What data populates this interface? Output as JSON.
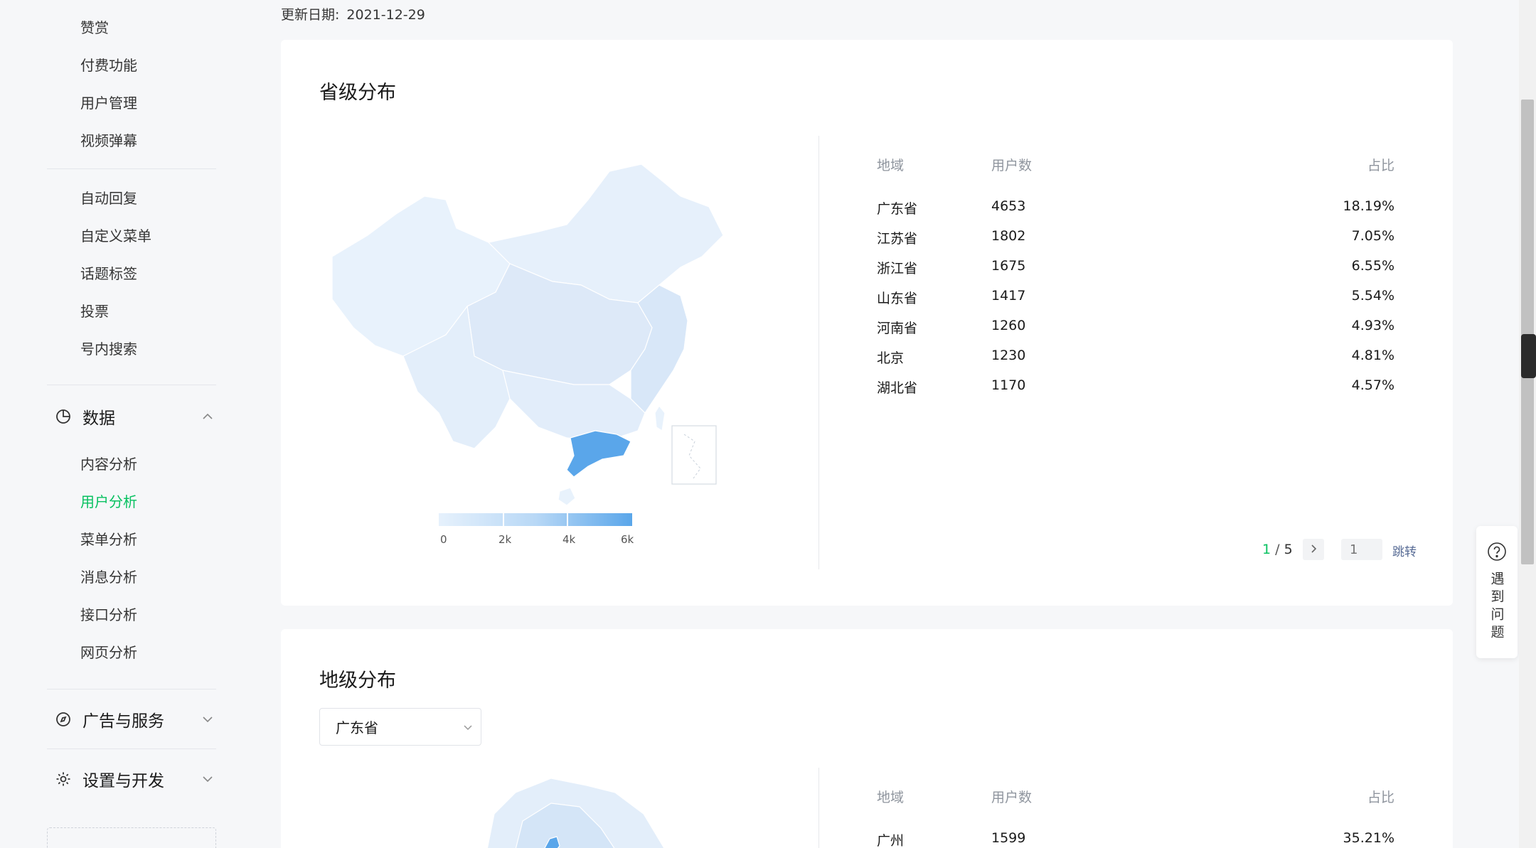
{
  "sidebar": {
    "top_items": [
      {
        "label": "赞赏"
      },
      {
        "label": "付费功能"
      },
      {
        "label": "用户管理"
      },
      {
        "label": "视频弹幕"
      }
    ],
    "mid_items": [
      {
        "label": "自动回复"
      },
      {
        "label": "自定义菜单"
      },
      {
        "label": "话题标签"
      },
      {
        "label": "投票"
      },
      {
        "label": "号内搜索"
      }
    ],
    "data_group": {
      "label": "数据",
      "icon": "pie-chart-icon",
      "expanded": true,
      "items": [
        {
          "label": "内容分析"
        },
        {
          "label": "用户分析",
          "active": true
        },
        {
          "label": "菜单分析"
        },
        {
          "label": "消息分析"
        },
        {
          "label": "接口分析"
        },
        {
          "label": "网页分析"
        }
      ]
    },
    "ads_group": {
      "label": "广告与服务",
      "icon": "compass-icon"
    },
    "settings_group": {
      "label": "设置与开发",
      "icon": "gear-icon"
    },
    "active_color": "#07c160"
  },
  "update": {
    "label": "更新日期:",
    "date": "2021-12-29"
  },
  "province": {
    "title": "省级分布",
    "headers": {
      "region": "地域",
      "users": "用户数",
      "ratio": "占比"
    },
    "rows": [
      {
        "region": "广东省",
        "users": "4653",
        "ratio": "18.19%"
      },
      {
        "region": "江苏省",
        "users": "1802",
        "ratio": "7.05%"
      },
      {
        "region": "浙江省",
        "users": "1675",
        "ratio": "6.55%"
      },
      {
        "region": "山东省",
        "users": "1417",
        "ratio": "5.54%"
      },
      {
        "region": "河南省",
        "users": "1260",
        "ratio": "4.93%"
      },
      {
        "region": "北京",
        "users": "1230",
        "ratio": "4.81%"
      },
      {
        "region": "湖北省",
        "users": "1170",
        "ratio": "4.57%"
      }
    ],
    "legend": {
      "labels": [
        "0",
        "2k",
        "4k",
        "6k"
      ],
      "low_color": "#e6f1fc",
      "high_color": "#5aa6ea"
    },
    "pager": {
      "current": "1",
      "sep": "/",
      "total": "5",
      "input_placeholder": "1",
      "jump": "跳转"
    }
  },
  "city": {
    "title": "地级分布",
    "select_value": "广东省",
    "headers": {
      "region": "地域",
      "users": "用户数",
      "ratio": "占比"
    },
    "rows": [
      {
        "region": "广州",
        "users": "1599",
        "ratio": "35.21%"
      }
    ]
  },
  "help": {
    "label": "遇到问题",
    "icon": "question-circle-icon"
  }
}
